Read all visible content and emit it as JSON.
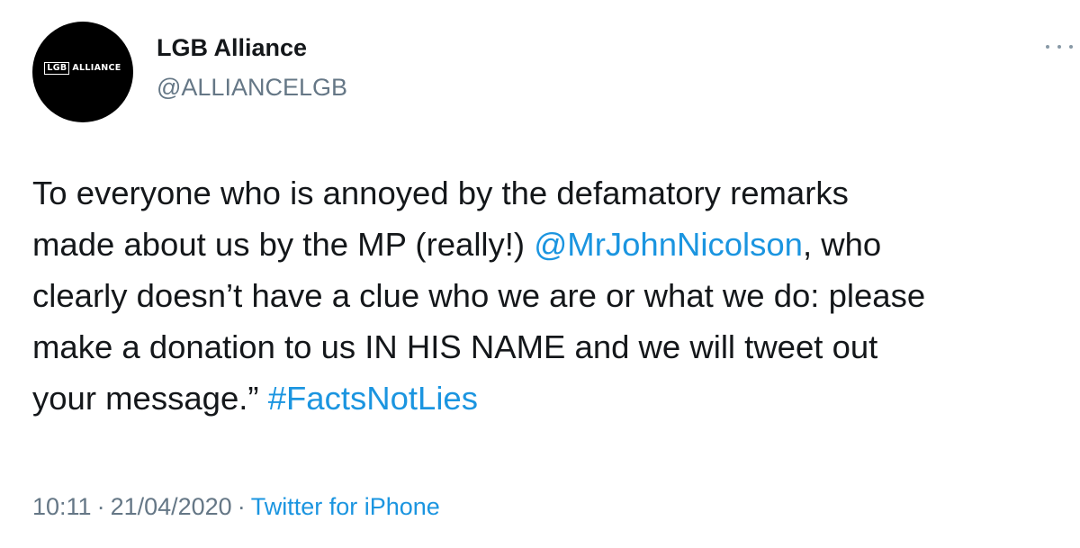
{
  "account": {
    "display_name": "LGB Alliance",
    "handle": "@ALLIANCELGB",
    "avatar_logo": {
      "box_text": "LGB",
      "rest_text": "ALLIANCE"
    }
  },
  "tweet": {
    "line1": "To everyone who is annoyed by the defamatory remarks",
    "line2_before": "made about us by the MP (really!) ",
    "line2_mention": "@MrJohnNicolson",
    "line2_after": ", who",
    "line3": "clearly doesn’t have a clue who we are or what we do: please",
    "line4": "make a donation to us IN HIS NAME and we will tweet out",
    "line5_before": "your message.” ",
    "line5_hashtag": "#FactsNotLies"
  },
  "meta": {
    "time": "10:11",
    "separator": "·",
    "date": "21/04/2020",
    "source": "Twitter for iPhone"
  },
  "colors": {
    "link": "#1b95e0",
    "secondary_text": "#657786",
    "primary_text": "#14171a",
    "avatar_bg": "#000000"
  },
  "icons": {
    "more": "more-options-icon"
  }
}
